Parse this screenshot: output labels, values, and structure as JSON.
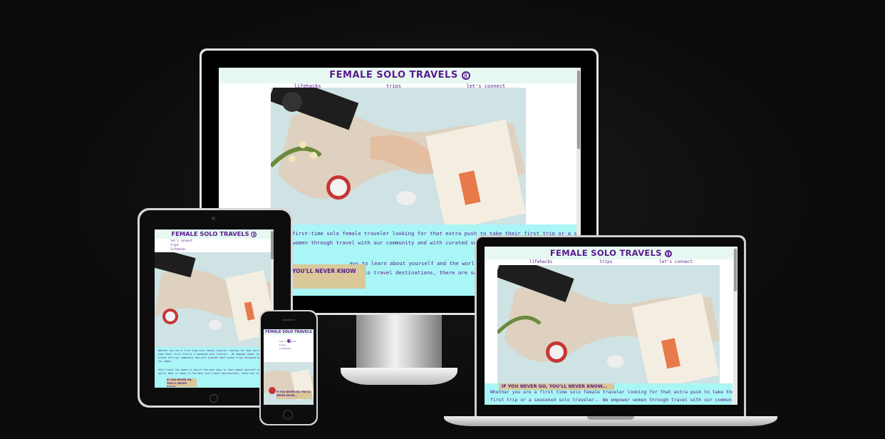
{
  "site": {
    "title": "FEMALE SOLO TRAVELS",
    "nav": [
      "lifehacks",
      "trips",
      "let's connect"
    ],
    "nav_icons": [
      "external-link-icon",
      "suitcase-icon",
      "people-icon"
    ],
    "intro_desktop_line1": "first-time solo female traveler looking for that extra push to take their first trip or a seasoned solo",
    "intro_desktop_line2": "women through travel with our community and with curated sma",
    "intro_desktop_line3": "ays to learn about yourself and the world.",
    "intro_desktop_line4": "it comes to the best solo travel destinations, there are so many",
    "tagline": "IF YOU NEVER GO, YOU'LL NEVER KNOW...",
    "tagline_short": "YOU'LL NEVER KNOW",
    "intro_laptop_line1": "Whether you are a first time solo female traveler looking for that extra push to take their",
    "intro_laptop_line2": "first trip or a seasoned solo traveler.. We empower women through travel with our community",
    "intro_tablet_p1": "Whether you are a first time solo female traveler looking for that extra push to take their first trip or a seasoned solo traveler.. We empower women through travel with our community and with curated small group trips designed by women for women",
    "intro_tablet_p2": "Solo travel for women is one of the best ways to learn about yourself and the world. When it comes to the best solo travel destinations, there are so many",
    "tagline_tablet": "IF YOU NEVER GO, YOU'LL NEVER KNOW...",
    "tagline_phone": "IF YOU NEVER GO, YOU'LL NEVER KNOW..."
  },
  "colors": {
    "brand_purple": "#5a1b8e",
    "header_bg": "#e6f8f1",
    "intro_bg": "#a9f6f6",
    "tagline_bg": "#d9c89a",
    "page_bg": "#0c0c0d"
  }
}
